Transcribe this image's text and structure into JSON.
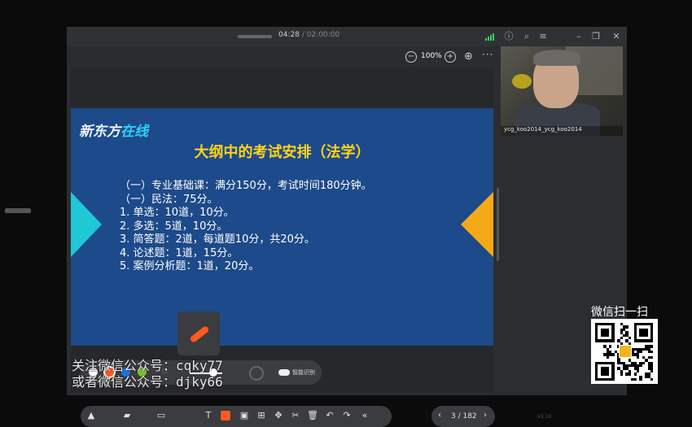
{
  "player": {
    "time_current": "04:28",
    "time_total": "/ 02:00:00",
    "zoom_level": "100%"
  },
  "slide": {
    "logo_prefix": "新东方",
    "logo_suffix": "在线",
    "title": "大纲中的考试安排（法学）",
    "lines": [
      "（一）专业基础课：满分150分，考试时间180分钟。",
      "（一）民法：75分。",
      "1. 单选：10道，10分。",
      "2. 多选：5道，10分。",
      "3. 简答题：2道，每道题10分，共20分。",
      "4. 论述题：1道，15分。",
      "5. 案例分析题：1道，20分。"
    ]
  },
  "annotation": {
    "colors": [
      "#ffffff",
      "#ff5a1f",
      "#1e6fe6",
      "#7bc52a"
    ],
    "selected_color_index": 1,
    "smart_label": "智能识别"
  },
  "pagination": {
    "prev": "‹",
    "current_total": "3 / 182",
    "next": "›"
  },
  "video": {
    "participant_name": "ycg_koo2014_ycg_koo2014"
  },
  "watermark": {
    "line1": "关注微信公众号：cqky77",
    "line2": "或者微信公众号：djky66"
  },
  "qr": {
    "label": "微信扫一扫"
  },
  "version": "V1.10"
}
